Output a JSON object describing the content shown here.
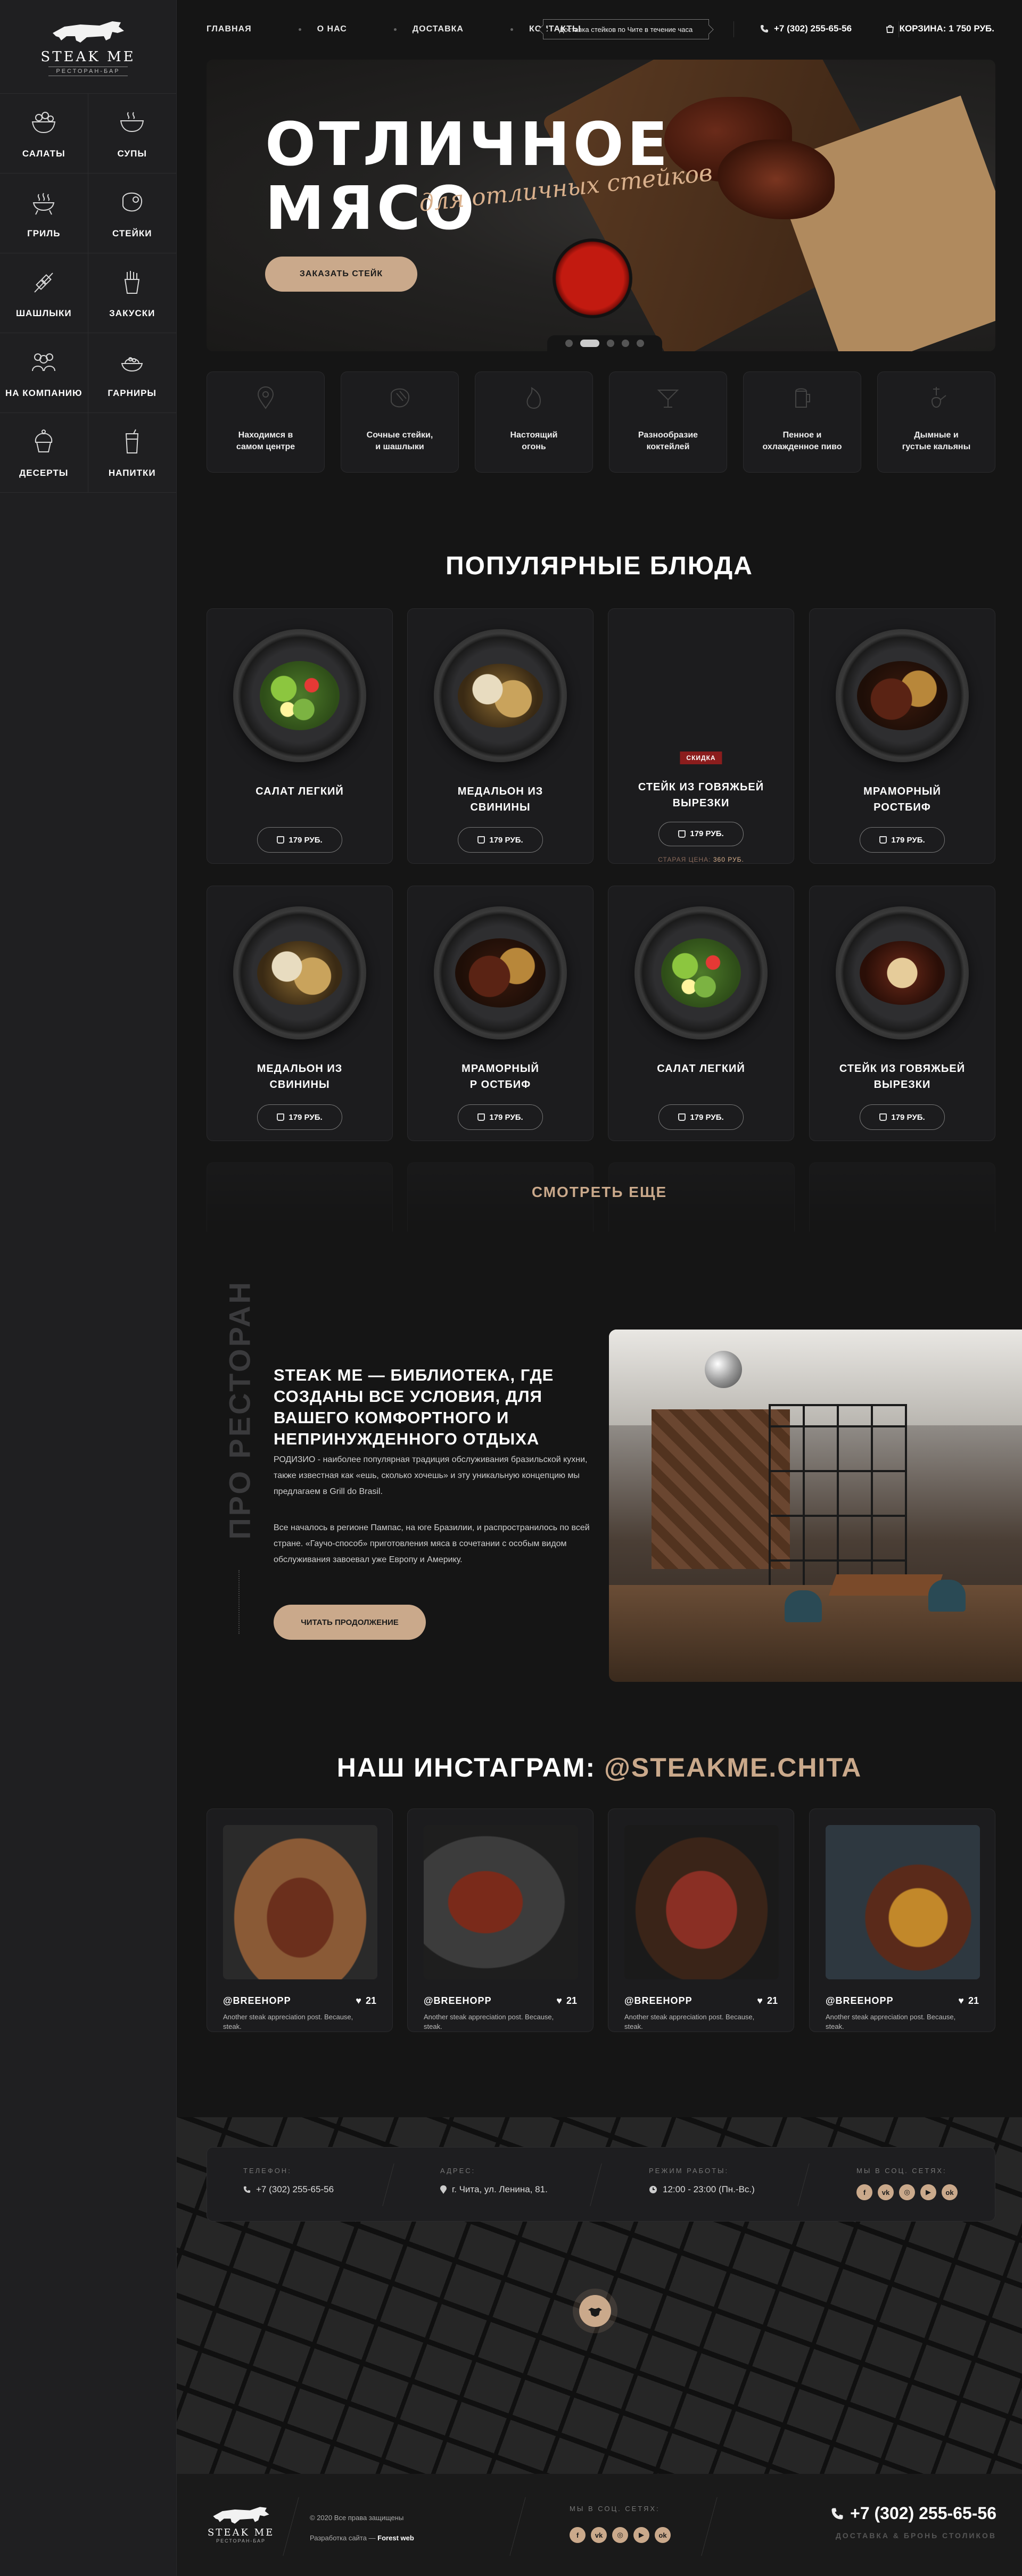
{
  "brand": {
    "name": "STEAK ME",
    "sub": "РЕСТОРАН-БАР"
  },
  "sidebar": {
    "items": [
      {
        "label": "САЛАТЫ",
        "icon": "salad-icon"
      },
      {
        "label": "СУПЫ",
        "icon": "soup-icon"
      },
      {
        "label": "ГРИЛЬ",
        "icon": "grill-icon"
      },
      {
        "label": "СТЕЙКИ",
        "icon": "steak-icon"
      },
      {
        "label": "ШАШЛЫКИ",
        "icon": "skewer-icon"
      },
      {
        "label": "ЗАКУСКИ",
        "icon": "fries-icon"
      },
      {
        "label": "НА КОМПАНИЮ",
        "icon": "group-icon"
      },
      {
        "label": "ГАРНИРЫ",
        "icon": "side-dish-icon"
      },
      {
        "label": "ДЕСЕРТЫ",
        "icon": "cupcake-icon"
      },
      {
        "label": "НАПИТКИ",
        "icon": "drink-icon"
      }
    ]
  },
  "nav": {
    "links": [
      "ГЛАВНАЯ",
      "О НАС",
      "ДОСТАВКА",
      "КОНТАКТЫ"
    ],
    "delivery_badge": "Доставка стейков по Чите в течение часа",
    "phone": "+7 (302) 255-65-56",
    "cart": "КОРЗИНА: 1 750 РУБ."
  },
  "hero": {
    "title_line1": "ОТЛИЧНОЕ",
    "title_line2": "МЯСО",
    "subtitle": "для отличных стейков",
    "button": "ЗАКАЗАТЬ СТЕЙК",
    "slides": 5,
    "active_slide": 2
  },
  "features": [
    {
      "label": "Находимся в\nсамом центре",
      "icon": "location-icon"
    },
    {
      "label": "Сочные стейки,\nи шашлыки",
      "icon": "steak-icon"
    },
    {
      "label": "Настоящий\nогонь",
      "icon": "fire-icon"
    },
    {
      "label": "Разнообразие\nкоктейлей",
      "icon": "cocktail-icon"
    },
    {
      "label": "Пенное и\nохлажденное пиво",
      "icon": "beer-icon"
    },
    {
      "label": "Дымные и\nгустые кальяны",
      "icon": "hookah-icon"
    }
  ],
  "popular": {
    "title": "ПОПУЛЯРНЫЕ БЛЮДА",
    "dishes": [
      {
        "name": "САЛАТ ЛЕГКИЙ",
        "price": "179 РУБ.",
        "food": "salad"
      },
      {
        "name": "МЕДАЛЬОН ИЗ\nСВИНИНЫ",
        "price": "179 РУБ.",
        "food": "medal"
      },
      {
        "name": "СТЕЙК ИЗ ГОВЯЖЬЕЙ\nВЫРЕЗКИ",
        "price": "179 РУБ.",
        "food": "none",
        "badge": "СКИДКА",
        "old_price_label": "СТАРАЯ ЦЕНА:",
        "old_price": "360 РУБ."
      },
      {
        "name": "МРАМОРНЫЙ\nРОСТБИФ",
        "price": "179 РУБ.",
        "food": "steak"
      },
      {
        "name": "МЕДАЛЬОН ИЗ\nСВИНИНЫ",
        "price": "179 РУБ.",
        "food": "medal"
      },
      {
        "name": "МРАМОРНЫЙ\nР ОСТБИФ",
        "price": "179 РУБ.",
        "food": "steak"
      },
      {
        "name": "САЛАТ ЛЕГКИЙ",
        "price": "179 РУБ.",
        "food": "salad"
      },
      {
        "name": "СТЕЙК ИЗ ГОВЯЖЬЕЙ\nВЫРЕЗКИ",
        "price": "179 РУБ.",
        "food": "fillet"
      }
    ],
    "see_more": "СМОТРЕТЬ ЕЩЕ"
  },
  "about": {
    "side_label": "ПРО РЕСТОРАН",
    "title": "STEAK ME — БИБЛИОТЕКА, ГДЕ СОЗДАНЫ ВСЕ УСЛОВИЯ, ДЛЯ ВАШЕГО КОМФОРТНОГО И НЕПРИНУЖДЕННОГО ОТДЫХА",
    "p1": "РОДИЗИО - наиболее популярная традиция обслуживания бразильской кухни, также известная как «ешь, сколько хочешь» и эту уникальную концепцию мы предлагаем в Grill do Brasil.",
    "p2": "Все началось в регионе Пампас, на юге Бразилии, и распространилось по всей стране. «Гаучо-способ» приготовления мяса в сочетании с особым видом обслуживания завоевал уже Европу и Америку.",
    "button": "ЧИТАТЬ ПРОДОЛЖЕНИЕ"
  },
  "instagram": {
    "title": "НАШ ИНСТАГРАМ:",
    "handle": "@STEAKME.CHITA",
    "posts": [
      {
        "user": "@BREEHOPP",
        "likes": "21",
        "text": "Another steak appreciation post. Because, steak."
      },
      {
        "user": "@BREEHOPP",
        "likes": "21",
        "text": "Another steak appreciation post. Because, steak."
      },
      {
        "user": "@BREEHOPP",
        "likes": "21",
        "text": "Another steak appreciation post. Because, steak."
      },
      {
        "user": "@BREEHOPP",
        "likes": "21",
        "text": "Another steak appreciation post. Because, steak."
      }
    ]
  },
  "contacts": {
    "phone_label": "ТЕЛЕФОН:",
    "phone": "+7 (302) 255-65-56",
    "address_label": "АДРЕС:",
    "address": "г. Чита, ул. Ленина, 81.",
    "hours_label": "РЕЖИМ РАБОТЫ:",
    "hours": "12:00 - 23:00 (Пн.-Вс.)",
    "social_label": "МЫ В СОЦ. СЕТЯХ:",
    "socials": [
      "f",
      "vk",
      "ig",
      "yt",
      "ok"
    ]
  },
  "footer": {
    "copyright": "© 2020 Все права защищены",
    "developer_label": "Разработка сайта —",
    "developer": "Forest web",
    "social_label": "МЫ В СОЦ. СЕТЯХ:",
    "phone": "+7 (302) 255-65-56",
    "phone_sub": "ДОСТАВКА & БРОНЬ СТОЛИКОВ"
  },
  "colors": {
    "accent": "#caa98b",
    "bg": "#151515",
    "sidebar": "#1f1f21",
    "card": "#1c1c1e",
    "badge": "#8b1d1d"
  }
}
